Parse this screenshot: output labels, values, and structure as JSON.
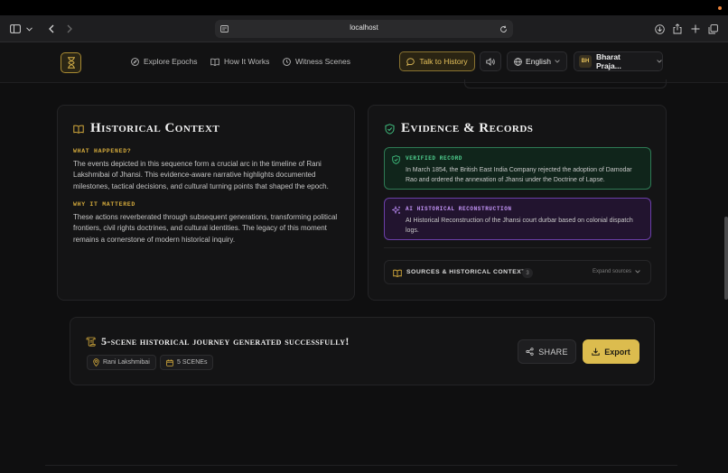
{
  "browser": {
    "url": "localhost"
  },
  "nav": {
    "links": [
      {
        "label": "Explore Epochs",
        "icon": "compass-icon"
      },
      {
        "label": "How It Works",
        "icon": "book-icon"
      },
      {
        "label": "Witness Scenes",
        "icon": "clock-icon"
      }
    ],
    "talk_label": "Talk to History",
    "language": "English",
    "user": {
      "initials": "BH",
      "name": "Bharat Praja..."
    }
  },
  "context": {
    "title": "Historical Context",
    "what_heading": "WHAT HAPPENED?",
    "what_text": "The events depicted in this sequence form a crucial arc in the timeline of Rani Lakshmibai of Jhansi. This evidence-aware narrative highlights documented milestones, tactical decisions, and cultural turning points that shaped the epoch.",
    "why_heading": "WHY IT MATTERED",
    "why_text": "These actions reverberated through subsequent generations, transforming political frontiers, civil rights doctrines, and cultural identities. The legacy of this moment remains a cornerstone of modern historical inquiry."
  },
  "evidence": {
    "title": "Evidence & Records",
    "verified": {
      "label": "VERIFIED RECORD",
      "text": "In March 1854, the British East India Company rejected the adoption of Damodar Rao and ordered the annexation of Jhansi under the Doctrine of Lapse.",
      "color": "#3fbf7f"
    },
    "ai": {
      "label": "AI HISTORICAL RECONSTRUCTION",
      "text": "AI Historical Reconstruction of the Jhansi court durbar based on colonial dispatch logs.",
      "color": "#a877e8"
    },
    "sources": {
      "label": "SOURCES & HISTORICAL CONTEXT",
      "count": "3",
      "expand": "Expand sources"
    }
  },
  "banner": {
    "headline": "5-scene historical journey generated successfully!",
    "chips": [
      {
        "label": "Rani Lakshmibai",
        "icon": "map-pin-icon"
      },
      {
        "label": "5 SCENEs",
        "icon": "calendar-icon"
      }
    ],
    "share_label": "SHARE",
    "export_label": "Export"
  },
  "colors": {
    "accent": "#dcbc4e",
    "background": "#0f0f10",
    "card": "#141415"
  }
}
